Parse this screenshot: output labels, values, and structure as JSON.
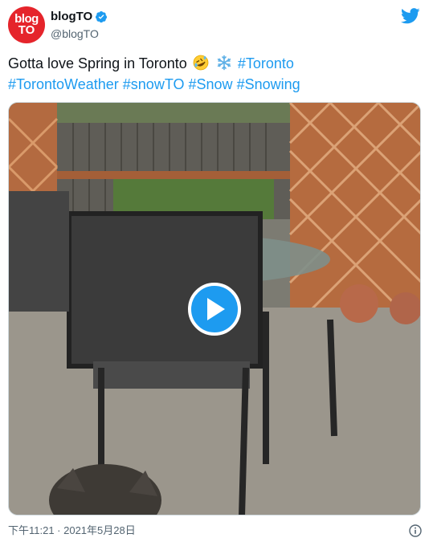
{
  "account": {
    "avatar_line1": "blog",
    "avatar_line2": "TO",
    "display_name": "blogTO",
    "handle": "@blogTO"
  },
  "tweet": {
    "text_plain": "Gotta love Spring in Toronto",
    "hashtags_line1": [
      "#Toronto"
    ],
    "hashtags_line2": [
      "#TorontoWeather",
      "#snowTO",
      "#Snow",
      "#Snowing"
    ],
    "emojis": [
      "rolling-on-floor-laughing-emoji",
      "snowflake-emoji"
    ]
  },
  "media": {
    "type": "video",
    "play_icon": "play-icon"
  },
  "footer": {
    "timestamp": "下午11:21 · 2021年5月28日"
  },
  "colors": {
    "link": "#1d9bf0",
    "avatar_bg": "#e5242b",
    "muted": "#536471"
  }
}
